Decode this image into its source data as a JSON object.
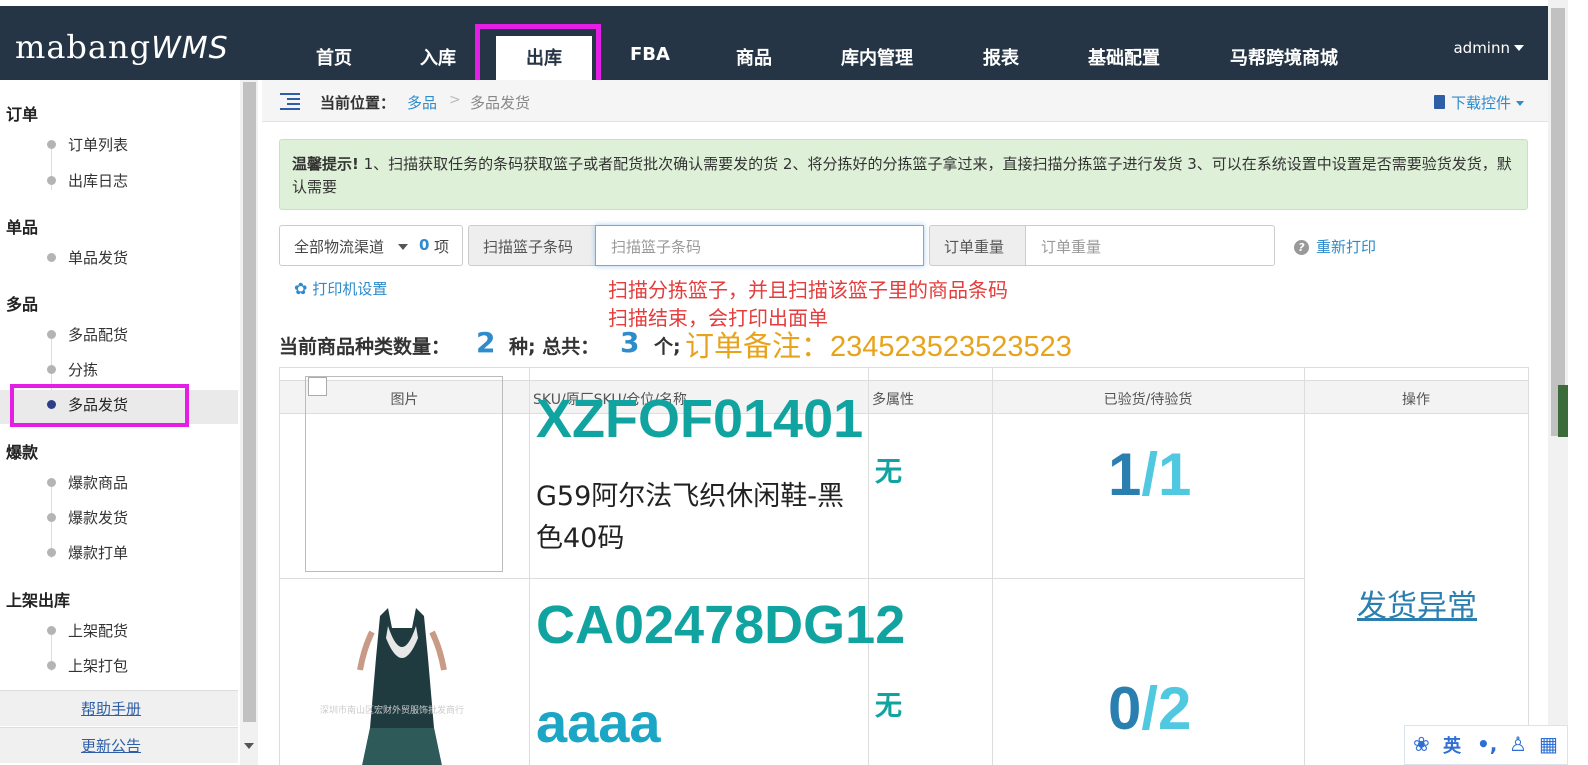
{
  "app": {
    "logo_main": "mabang",
    "logo_suffix": "WMS",
    "user": "adminn"
  },
  "nav": {
    "items": [
      "首页",
      "入库",
      "出库",
      "FBA",
      "商品",
      "库内管理",
      "报表",
      "基础配置",
      "马帮跨境商城"
    ],
    "active": "出库"
  },
  "sidebar": {
    "groups": [
      {
        "title": "订单",
        "items": [
          "订单列表",
          "出库日志"
        ]
      },
      {
        "title": "单品",
        "items": [
          "单品发货"
        ]
      },
      {
        "title": "多品",
        "items": [
          "多品配货",
          "分拣",
          "多品发货"
        ]
      },
      {
        "title": "爆款",
        "items": [
          "爆款商品",
          "爆款发货",
          "爆款打单"
        ]
      },
      {
        "title": "上架出库",
        "items": [
          "上架配货",
          "上架打包"
        ]
      }
    ],
    "active_item": "多品发货",
    "help": "帮助手册",
    "announce": "更新公告"
  },
  "breadcrumb": {
    "label": "当前位置：",
    "link": "多品",
    "sep": ">",
    "current": "多品发货",
    "download": "下载控件"
  },
  "tip": {
    "title": "温馨提示!",
    "text": " 1、扫描获取任务的条码获取篮子或者配货批次确认需要发的货    2、将分拣好的分拣篮子拿过来，直接扫描分拣篮子进行发货    3、可以在系统设置中设置是否需要验货发货，默认需要"
  },
  "controls": {
    "channel": "全部物流渠道",
    "channel_count": "0",
    "channel_unit": "项",
    "basket_label": "扫描篮子条码",
    "basket_placeholder": "扫描篮子条码",
    "weight_label": "订单重量",
    "weight_placeholder": "订单重量",
    "reprint": "重新打印",
    "printer": "打印机设置"
  },
  "annotation": {
    "line1": "扫描分拣篮子，并且扫描该篮子里的商品条码",
    "line2": "扫描结束，会打印出面单"
  },
  "stats": {
    "kinds_label": "当前商品种类数量：",
    "kinds": "2",
    "kinds_unit": "种; 总共：",
    "total": "3",
    "total_unit": "个;",
    "remark": "订单备注：234523523523523"
  },
  "table": {
    "headers": [
      "图片",
      "SKU/原厂SKU/仓位/名称",
      "多属性",
      "已验货/待验货",
      "操作"
    ],
    "rows": [
      {
        "sku": "XZFOF01401",
        "name": "G59阿尔法飞织休闲鞋-黑色40码",
        "attr": "无",
        "checked": "1",
        "pending": "1"
      },
      {
        "sku": "CA02478DG12",
        "sku2": "aaaa",
        "attr": "无",
        "checked": "0",
        "pending": "2",
        "watermark": "深圳市南山区宏财外贸服饰批发商行"
      }
    ],
    "action": "发货异常"
  },
  "ime": {
    "lang": "英"
  },
  "colors": {
    "topbar": "#263545",
    "accent": "#2e8bcc",
    "highlight": "#e51ee5",
    "sku": "#11a3a0",
    "remark": "#e8a31c",
    "annotation": "#e53c3c"
  }
}
